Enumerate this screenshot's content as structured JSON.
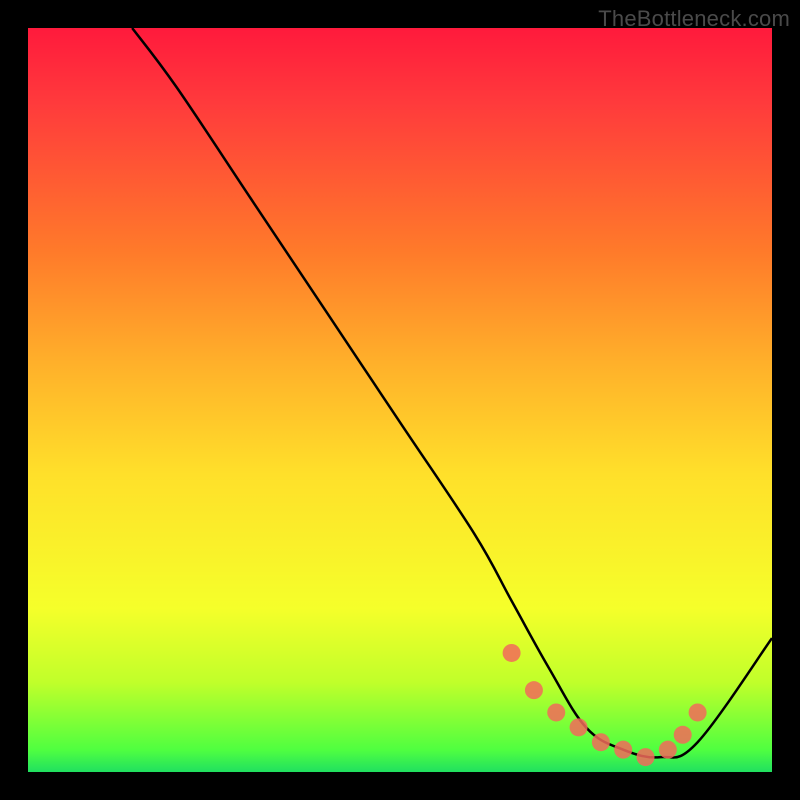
{
  "watermark": "TheBottleneck.com",
  "chart_data": {
    "type": "line",
    "title": "",
    "xlabel": "",
    "ylabel": "",
    "xlim": [
      0,
      100
    ],
    "ylim": [
      0,
      100
    ],
    "series": [
      {
        "name": "bottleneck-curve",
        "x": [
          14,
          20,
          30,
          40,
          50,
          60,
          65,
          70,
          75,
          80,
          85,
          90,
          100
        ],
        "values": [
          100,
          92,
          77,
          62,
          47,
          32,
          23,
          14,
          6,
          3,
          2,
          4,
          18
        ]
      }
    ],
    "markers": {
      "name": "highlight-points",
      "x": [
        65,
        68,
        71,
        74,
        77,
        80,
        83,
        86,
        88,
        90
      ],
      "values": [
        16,
        11,
        8,
        6,
        4,
        3,
        2,
        3,
        5,
        8
      ],
      "color": "#f26a5a"
    },
    "colors": {
      "curve": "#000000",
      "marker": "#f26a5a",
      "gradient_top": "#ff1a3c",
      "gradient_bottom": "#20e060",
      "frame": "#000000"
    }
  }
}
